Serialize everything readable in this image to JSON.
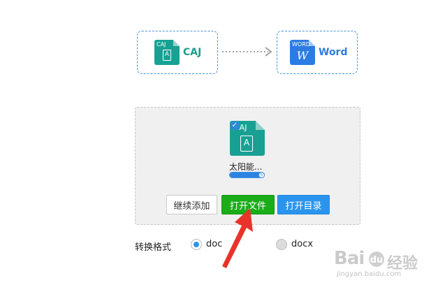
{
  "conversion": {
    "source": {
      "badge": "CAJ",
      "glyph": "A",
      "label": "CAJ",
      "icon": "caj-file-icon"
    },
    "target": {
      "badge": "WORD",
      "glyph": "W",
      "label": "Word",
      "icon": "word-file-icon"
    },
    "arrow_icon": "dotted-right-arrow-icon"
  },
  "file": {
    "badge": "CAJ",
    "glyph": "A",
    "name": "太阳能...",
    "progress_fraction": 0.85,
    "icon": "caj-file-icon"
  },
  "buttons": {
    "continue_add": "继续添加",
    "open_file": "打开文件",
    "open_folder": "打开目录"
  },
  "format": {
    "label": "转换格式",
    "options": [
      "doc",
      "docx"
    ],
    "selected": "doc"
  },
  "watermark": {
    "url": "jingyan.baidu.com"
  },
  "colors": {
    "caj_teal": "#18a193",
    "word_blue": "#2c7be5",
    "open_green": "#1aad19",
    "folder_blue": "#2b95ee",
    "annotation_red": "#e8332a"
  }
}
